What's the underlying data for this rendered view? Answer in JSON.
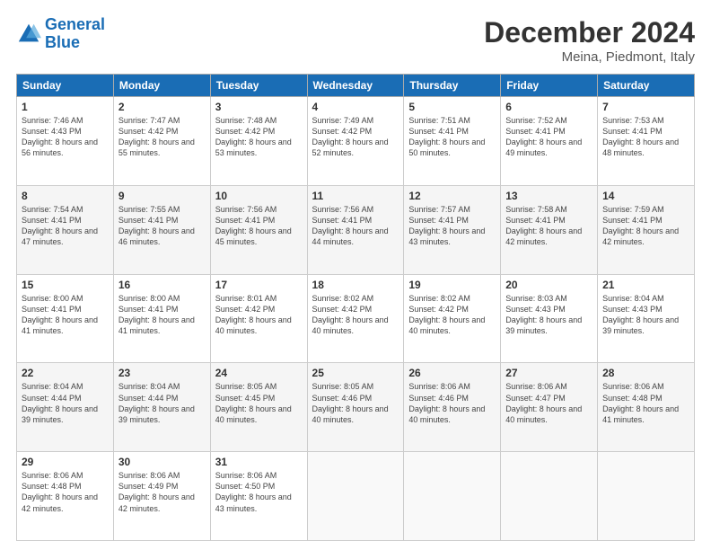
{
  "logo": {
    "line1": "General",
    "line2": "Blue"
  },
  "title": "December 2024",
  "subtitle": "Meina, Piedmont, Italy",
  "weekdays": [
    "Sunday",
    "Monday",
    "Tuesday",
    "Wednesday",
    "Thursday",
    "Friday",
    "Saturday"
  ],
  "weeks": [
    [
      {
        "day": "1",
        "sunrise": "7:46 AM",
        "sunset": "4:43 PM",
        "daylight": "8 hours and 56 minutes."
      },
      {
        "day": "2",
        "sunrise": "7:47 AM",
        "sunset": "4:42 PM",
        "daylight": "8 hours and 55 minutes."
      },
      {
        "day": "3",
        "sunrise": "7:48 AM",
        "sunset": "4:42 PM",
        "daylight": "8 hours and 53 minutes."
      },
      {
        "day": "4",
        "sunrise": "7:49 AM",
        "sunset": "4:42 PM",
        "daylight": "8 hours and 52 minutes."
      },
      {
        "day": "5",
        "sunrise": "7:51 AM",
        "sunset": "4:41 PM",
        "daylight": "8 hours and 50 minutes."
      },
      {
        "day": "6",
        "sunrise": "7:52 AM",
        "sunset": "4:41 PM",
        "daylight": "8 hours and 49 minutes."
      },
      {
        "day": "7",
        "sunrise": "7:53 AM",
        "sunset": "4:41 PM",
        "daylight": "8 hours and 48 minutes."
      }
    ],
    [
      {
        "day": "8",
        "sunrise": "7:54 AM",
        "sunset": "4:41 PM",
        "daylight": "8 hours and 47 minutes."
      },
      {
        "day": "9",
        "sunrise": "7:55 AM",
        "sunset": "4:41 PM",
        "daylight": "8 hours and 46 minutes."
      },
      {
        "day": "10",
        "sunrise": "7:56 AM",
        "sunset": "4:41 PM",
        "daylight": "8 hours and 45 minutes."
      },
      {
        "day": "11",
        "sunrise": "7:56 AM",
        "sunset": "4:41 PM",
        "daylight": "8 hours and 44 minutes."
      },
      {
        "day": "12",
        "sunrise": "7:57 AM",
        "sunset": "4:41 PM",
        "daylight": "8 hours and 43 minutes."
      },
      {
        "day": "13",
        "sunrise": "7:58 AM",
        "sunset": "4:41 PM",
        "daylight": "8 hours and 42 minutes."
      },
      {
        "day": "14",
        "sunrise": "7:59 AM",
        "sunset": "4:41 PM",
        "daylight": "8 hours and 42 minutes."
      }
    ],
    [
      {
        "day": "15",
        "sunrise": "8:00 AM",
        "sunset": "4:41 PM",
        "daylight": "8 hours and 41 minutes."
      },
      {
        "day": "16",
        "sunrise": "8:00 AM",
        "sunset": "4:41 PM",
        "daylight": "8 hours and 41 minutes."
      },
      {
        "day": "17",
        "sunrise": "8:01 AM",
        "sunset": "4:42 PM",
        "daylight": "8 hours and 40 minutes."
      },
      {
        "day": "18",
        "sunrise": "8:02 AM",
        "sunset": "4:42 PM",
        "daylight": "8 hours and 40 minutes."
      },
      {
        "day": "19",
        "sunrise": "8:02 AM",
        "sunset": "4:42 PM",
        "daylight": "8 hours and 40 minutes."
      },
      {
        "day": "20",
        "sunrise": "8:03 AM",
        "sunset": "4:43 PM",
        "daylight": "8 hours and 39 minutes."
      },
      {
        "day": "21",
        "sunrise": "8:04 AM",
        "sunset": "4:43 PM",
        "daylight": "8 hours and 39 minutes."
      }
    ],
    [
      {
        "day": "22",
        "sunrise": "8:04 AM",
        "sunset": "4:44 PM",
        "daylight": "8 hours and 39 minutes."
      },
      {
        "day": "23",
        "sunrise": "8:04 AM",
        "sunset": "4:44 PM",
        "daylight": "8 hours and 39 minutes."
      },
      {
        "day": "24",
        "sunrise": "8:05 AM",
        "sunset": "4:45 PM",
        "daylight": "8 hours and 40 minutes."
      },
      {
        "day": "25",
        "sunrise": "8:05 AM",
        "sunset": "4:46 PM",
        "daylight": "8 hours and 40 minutes."
      },
      {
        "day": "26",
        "sunrise": "8:06 AM",
        "sunset": "4:46 PM",
        "daylight": "8 hours and 40 minutes."
      },
      {
        "day": "27",
        "sunrise": "8:06 AM",
        "sunset": "4:47 PM",
        "daylight": "8 hours and 40 minutes."
      },
      {
        "day": "28",
        "sunrise": "8:06 AM",
        "sunset": "4:48 PM",
        "daylight": "8 hours and 41 minutes."
      }
    ],
    [
      {
        "day": "29",
        "sunrise": "8:06 AM",
        "sunset": "4:48 PM",
        "daylight": "8 hours and 42 minutes."
      },
      {
        "day": "30",
        "sunrise": "8:06 AM",
        "sunset": "4:49 PM",
        "daylight": "8 hours and 42 minutes."
      },
      {
        "day": "31",
        "sunrise": "8:06 AM",
        "sunset": "4:50 PM",
        "daylight": "8 hours and 43 minutes."
      },
      null,
      null,
      null,
      null
    ]
  ],
  "labels": {
    "sunrise": "Sunrise:",
    "sunset": "Sunset:",
    "daylight": "Daylight:"
  }
}
